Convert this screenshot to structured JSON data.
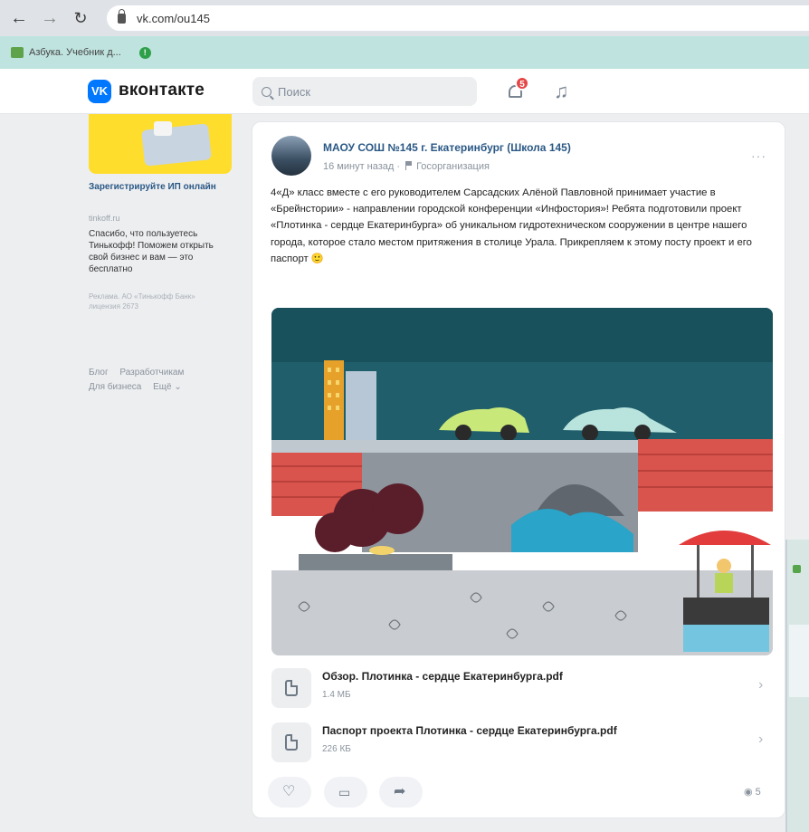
{
  "browser": {
    "url": "vk.com/ou145",
    "back_icon": "arrow-left-icon",
    "forward_icon": "arrow-right-icon",
    "reload_icon": "reload-icon",
    "bookmark_label": "Азбука. Учебник д...",
    "colors": {
      "toolbar": "#dfe3e8",
      "bookmarks_bar": "#bfe3df"
    }
  },
  "header": {
    "logo_text": "VK",
    "brand": "вконтакте",
    "search_placeholder": "Поиск",
    "notifications_count": "5",
    "accent": "#0077ff"
  },
  "ad": {
    "title": "Зарегистрируйте ИП онлайн",
    "domain": "tinkoff.ru",
    "text": "Спасибо, что пользуетесь Тинькофф! Поможем открыть свой бизнес и вам — это бесплатно",
    "legal": "Реклама. АО «Тинькофф Банк» лицензия 2673"
  },
  "footer_links": [
    "Блог",
    "Разработчикам",
    "Для бизнеса",
    "Ещё ⌄"
  ],
  "post": {
    "author": "МАОУ СОШ №145 г. Екатеринбург (Школа 145)",
    "time": "16 минут назад",
    "org_label": "Госорганизация",
    "more": "···",
    "text": "4«Д» класс вместе с его руководителем Сарсадских Алёной Павловной принимает участие в «Брейнстории» - направлении городской конференции «Инфостория»! Ребята подготовили проект «Плотинка - сердце Екатеринбурга» об уникальном гидротехническом сооружении в центре нашего города, которое стало местом притяжения в столице Урала. Прикрепляем к этому посту проект и его паспорт 🙂",
    "attachments": [
      {
        "name": "Обзор. Плотинка - сердце Екатеринбурга.pdf",
        "size": "1.4 МБ"
      },
      {
        "name": "Паспорт проекта Плотинка - сердце Екатеринбурга.pdf",
        "size": "226 КБ"
      }
    ],
    "views": "5"
  }
}
